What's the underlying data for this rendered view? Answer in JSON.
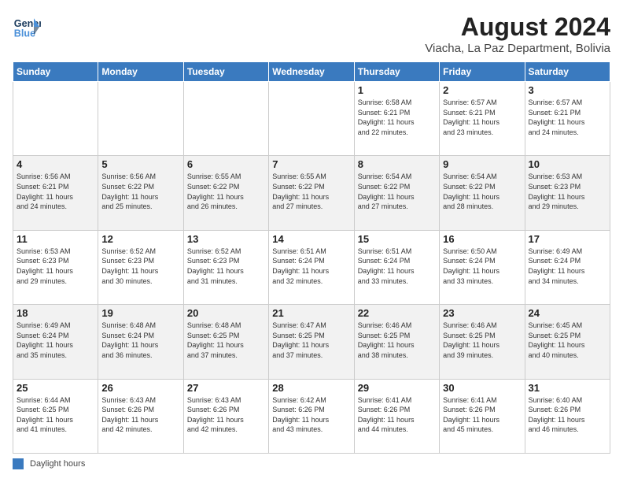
{
  "logo": {
    "line1": "General",
    "line2": "Blue"
  },
  "title": "August 2024",
  "subtitle": "Viacha, La Paz Department, Bolivia",
  "weekdays": [
    "Sunday",
    "Monday",
    "Tuesday",
    "Wednesday",
    "Thursday",
    "Friday",
    "Saturday"
  ],
  "weeks": [
    [
      {
        "day": "",
        "info": ""
      },
      {
        "day": "",
        "info": ""
      },
      {
        "day": "",
        "info": ""
      },
      {
        "day": "",
        "info": ""
      },
      {
        "day": "1",
        "info": "Sunrise: 6:58 AM\nSunset: 6:21 PM\nDaylight: 11 hours\nand 22 minutes."
      },
      {
        "day": "2",
        "info": "Sunrise: 6:57 AM\nSunset: 6:21 PM\nDaylight: 11 hours\nand 23 minutes."
      },
      {
        "day": "3",
        "info": "Sunrise: 6:57 AM\nSunset: 6:21 PM\nDaylight: 11 hours\nand 24 minutes."
      }
    ],
    [
      {
        "day": "4",
        "info": "Sunrise: 6:56 AM\nSunset: 6:21 PM\nDaylight: 11 hours\nand 24 minutes."
      },
      {
        "day": "5",
        "info": "Sunrise: 6:56 AM\nSunset: 6:22 PM\nDaylight: 11 hours\nand 25 minutes."
      },
      {
        "day": "6",
        "info": "Sunrise: 6:55 AM\nSunset: 6:22 PM\nDaylight: 11 hours\nand 26 minutes."
      },
      {
        "day": "7",
        "info": "Sunrise: 6:55 AM\nSunset: 6:22 PM\nDaylight: 11 hours\nand 27 minutes."
      },
      {
        "day": "8",
        "info": "Sunrise: 6:54 AM\nSunset: 6:22 PM\nDaylight: 11 hours\nand 27 minutes."
      },
      {
        "day": "9",
        "info": "Sunrise: 6:54 AM\nSunset: 6:22 PM\nDaylight: 11 hours\nand 28 minutes."
      },
      {
        "day": "10",
        "info": "Sunrise: 6:53 AM\nSunset: 6:23 PM\nDaylight: 11 hours\nand 29 minutes."
      }
    ],
    [
      {
        "day": "11",
        "info": "Sunrise: 6:53 AM\nSunset: 6:23 PM\nDaylight: 11 hours\nand 29 minutes."
      },
      {
        "day": "12",
        "info": "Sunrise: 6:52 AM\nSunset: 6:23 PM\nDaylight: 11 hours\nand 30 minutes."
      },
      {
        "day": "13",
        "info": "Sunrise: 6:52 AM\nSunset: 6:23 PM\nDaylight: 11 hours\nand 31 minutes."
      },
      {
        "day": "14",
        "info": "Sunrise: 6:51 AM\nSunset: 6:24 PM\nDaylight: 11 hours\nand 32 minutes."
      },
      {
        "day": "15",
        "info": "Sunrise: 6:51 AM\nSunset: 6:24 PM\nDaylight: 11 hours\nand 33 minutes."
      },
      {
        "day": "16",
        "info": "Sunrise: 6:50 AM\nSunset: 6:24 PM\nDaylight: 11 hours\nand 33 minutes."
      },
      {
        "day": "17",
        "info": "Sunrise: 6:49 AM\nSunset: 6:24 PM\nDaylight: 11 hours\nand 34 minutes."
      }
    ],
    [
      {
        "day": "18",
        "info": "Sunrise: 6:49 AM\nSunset: 6:24 PM\nDaylight: 11 hours\nand 35 minutes."
      },
      {
        "day": "19",
        "info": "Sunrise: 6:48 AM\nSunset: 6:24 PM\nDaylight: 11 hours\nand 36 minutes."
      },
      {
        "day": "20",
        "info": "Sunrise: 6:48 AM\nSunset: 6:25 PM\nDaylight: 11 hours\nand 37 minutes."
      },
      {
        "day": "21",
        "info": "Sunrise: 6:47 AM\nSunset: 6:25 PM\nDaylight: 11 hours\nand 37 minutes."
      },
      {
        "day": "22",
        "info": "Sunrise: 6:46 AM\nSunset: 6:25 PM\nDaylight: 11 hours\nand 38 minutes."
      },
      {
        "day": "23",
        "info": "Sunrise: 6:46 AM\nSunset: 6:25 PM\nDaylight: 11 hours\nand 39 minutes."
      },
      {
        "day": "24",
        "info": "Sunrise: 6:45 AM\nSunset: 6:25 PM\nDaylight: 11 hours\nand 40 minutes."
      }
    ],
    [
      {
        "day": "25",
        "info": "Sunrise: 6:44 AM\nSunset: 6:25 PM\nDaylight: 11 hours\nand 41 minutes."
      },
      {
        "day": "26",
        "info": "Sunrise: 6:43 AM\nSunset: 6:26 PM\nDaylight: 11 hours\nand 42 minutes."
      },
      {
        "day": "27",
        "info": "Sunrise: 6:43 AM\nSunset: 6:26 PM\nDaylight: 11 hours\nand 42 minutes."
      },
      {
        "day": "28",
        "info": "Sunrise: 6:42 AM\nSunset: 6:26 PM\nDaylight: 11 hours\nand 43 minutes."
      },
      {
        "day": "29",
        "info": "Sunrise: 6:41 AM\nSunset: 6:26 PM\nDaylight: 11 hours\nand 44 minutes."
      },
      {
        "day": "30",
        "info": "Sunrise: 6:41 AM\nSunset: 6:26 PM\nDaylight: 11 hours\nand 45 minutes."
      },
      {
        "day": "31",
        "info": "Sunrise: 6:40 AM\nSunset: 6:26 PM\nDaylight: 11 hours\nand 46 minutes."
      }
    ]
  ],
  "legend": {
    "color_label": "Daylight hours",
    "color_hex": "#3a7abf"
  }
}
